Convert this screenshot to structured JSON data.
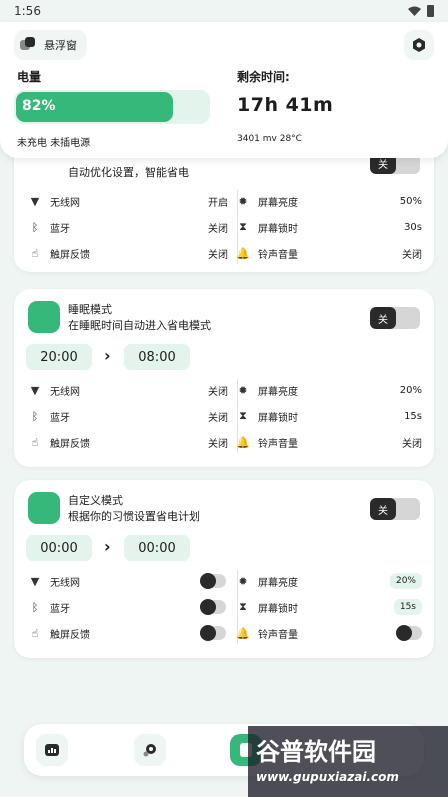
{
  "status_bar": {
    "time": "1:56"
  },
  "header": {
    "floating_label": "悬浮窗",
    "battery_label": "电量",
    "battery_percent_text": "82%",
    "battery_level": 0.82,
    "remaining_label": "剩余时间:",
    "remaining_time": "17h 41m",
    "charge_state": "未充电   未插电源",
    "voltage_temp": "3401 mv   28°C"
  },
  "cards": [
    {
      "desc": "自动优化设置，智能省电",
      "toggle_label": "关",
      "rows": [
        {
          "left_name": "无线网",
          "left_value": "开启",
          "right_name": "屏幕亮度",
          "right_value": "50%"
        },
        {
          "left_name": "蓝牙",
          "left_value": "关闭",
          "right_name": "屏幕锁时",
          "right_value": "30s"
        },
        {
          "left_name": "触屏反馈",
          "left_value": "关闭",
          "right_name": "铃声音量",
          "right_value": "关闭"
        }
      ]
    },
    {
      "title": "睡眠模式",
      "desc": "在睡眠时间自动进入省电模式",
      "toggle_label": "关",
      "start_time": "20:00",
      "end_time": "08:00",
      "rows": [
        {
          "left_name": "无线网",
          "left_value": "关闭",
          "right_name": "屏幕亮度",
          "right_value": "20%"
        },
        {
          "left_name": "蓝牙",
          "left_value": "关闭",
          "right_name": "屏幕锁时",
          "right_value": "15s"
        },
        {
          "left_name": "触屏反馈",
          "left_value": "关闭",
          "right_name": "铃声音量",
          "right_value": "关闭"
        }
      ]
    },
    {
      "title": "自定义模式",
      "desc": "根据你的习惯设置省电计划",
      "toggle_label": "关",
      "start_time": "00:00",
      "end_time": "00:00",
      "rows": [
        {
          "left_name": "无线网",
          "right_name": "屏幕亮度",
          "right_value": "20%"
        },
        {
          "left_name": "蓝牙",
          "right_name": "屏幕锁时",
          "right_value": "15s"
        },
        {
          "left_name": "触屏反馈",
          "right_name": "铃声音量"
        }
      ]
    }
  ],
  "watermark": {
    "brand": "谷普软件园",
    "url": "www.gupuxiazai.com"
  },
  "colors": {
    "accent": "#35b87a",
    "accent_light": "#e3f4ec",
    "dark": "#2a2a2a"
  }
}
